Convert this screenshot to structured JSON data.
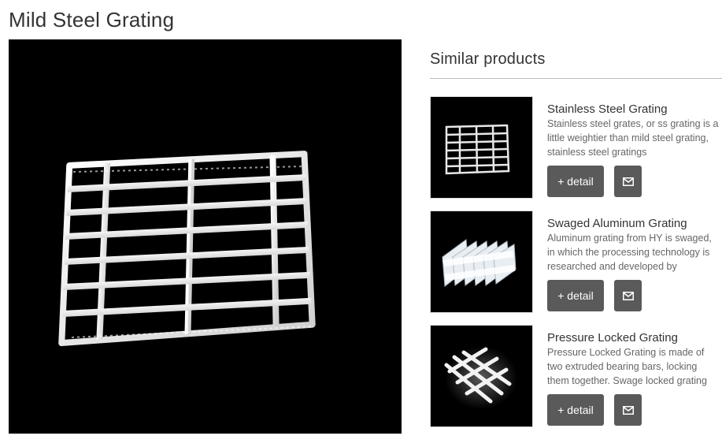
{
  "page": {
    "title": "Mild Steel Grating"
  },
  "main_image": {
    "alt_icon": "mild-steel-grating-photo"
  },
  "similar": {
    "title": "Similar products",
    "products": [
      {
        "name": "Stainless Steel Grating",
        "description": "Stainless steel grates, or ss grating is a little weightier than mild steel grating, stainless steel gratings",
        "detail_label": "+ detail",
        "mail_icon": "envelope-icon"
      },
      {
        "name": "Swaged Aluminum Grating",
        "description": "Aluminum grating from HY is swaged, in which the processing technology is researched and developed by",
        "detail_label": "+ detail",
        "mail_icon": "envelope-icon"
      },
      {
        "name": "Pressure Locked Grating",
        "description": "Pressure Locked Grating is made of two extruded bearing bars, locking them together. Swage locked grating",
        "detail_label": "+ detail",
        "mail_icon": "envelope-icon"
      }
    ]
  },
  "colors": {
    "button_bg": "#5a5a5a",
    "image_bg": "#000000",
    "title_text": "#333333",
    "desc_text": "#666666"
  }
}
